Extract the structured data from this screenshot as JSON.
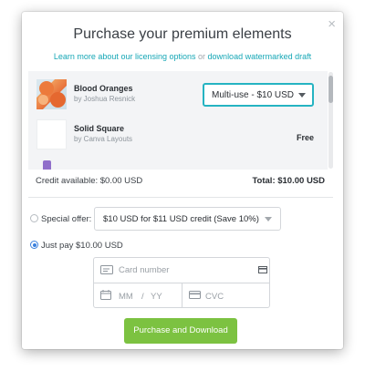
{
  "modal": {
    "title": "Purchase your premium elements",
    "close_glyph": "×",
    "links": {
      "licensing": "Learn more about our licensing options",
      "or": "or",
      "watermarked": "download watermarked draft"
    }
  },
  "items": [
    {
      "name": "Blood Oranges",
      "author": "by Joshua Resnick",
      "thumb_icon": "blood-oranges-photo",
      "license": "Multi-use - $10 USD"
    },
    {
      "name": "Solid Square",
      "author": "by Canva Layouts",
      "thumb_icon": "solid-square-graphic",
      "price": "Free"
    }
  ],
  "summary": {
    "credit": "Credit available: $0.00 USD",
    "total": "Total: $10.00 USD"
  },
  "payment": {
    "special_offer_label": "Special offer:",
    "special_offer_value": "$10 USD for $11 USD credit (Save 10%)",
    "just_pay_label": "Just pay $10.00 USD",
    "selected_option": "just-pay",
    "card_number_placeholder": "Card number",
    "mm_placeholder": "MM",
    "slash": "/",
    "yy_placeholder": "YY",
    "cvc_placeholder": "CVC"
  },
  "actions": {
    "purchase": "Purchase and Download"
  },
  "colors": {
    "accent": "#16a7b6",
    "primary_button": "#7cc241",
    "radio_selected": "#3b80dd"
  }
}
